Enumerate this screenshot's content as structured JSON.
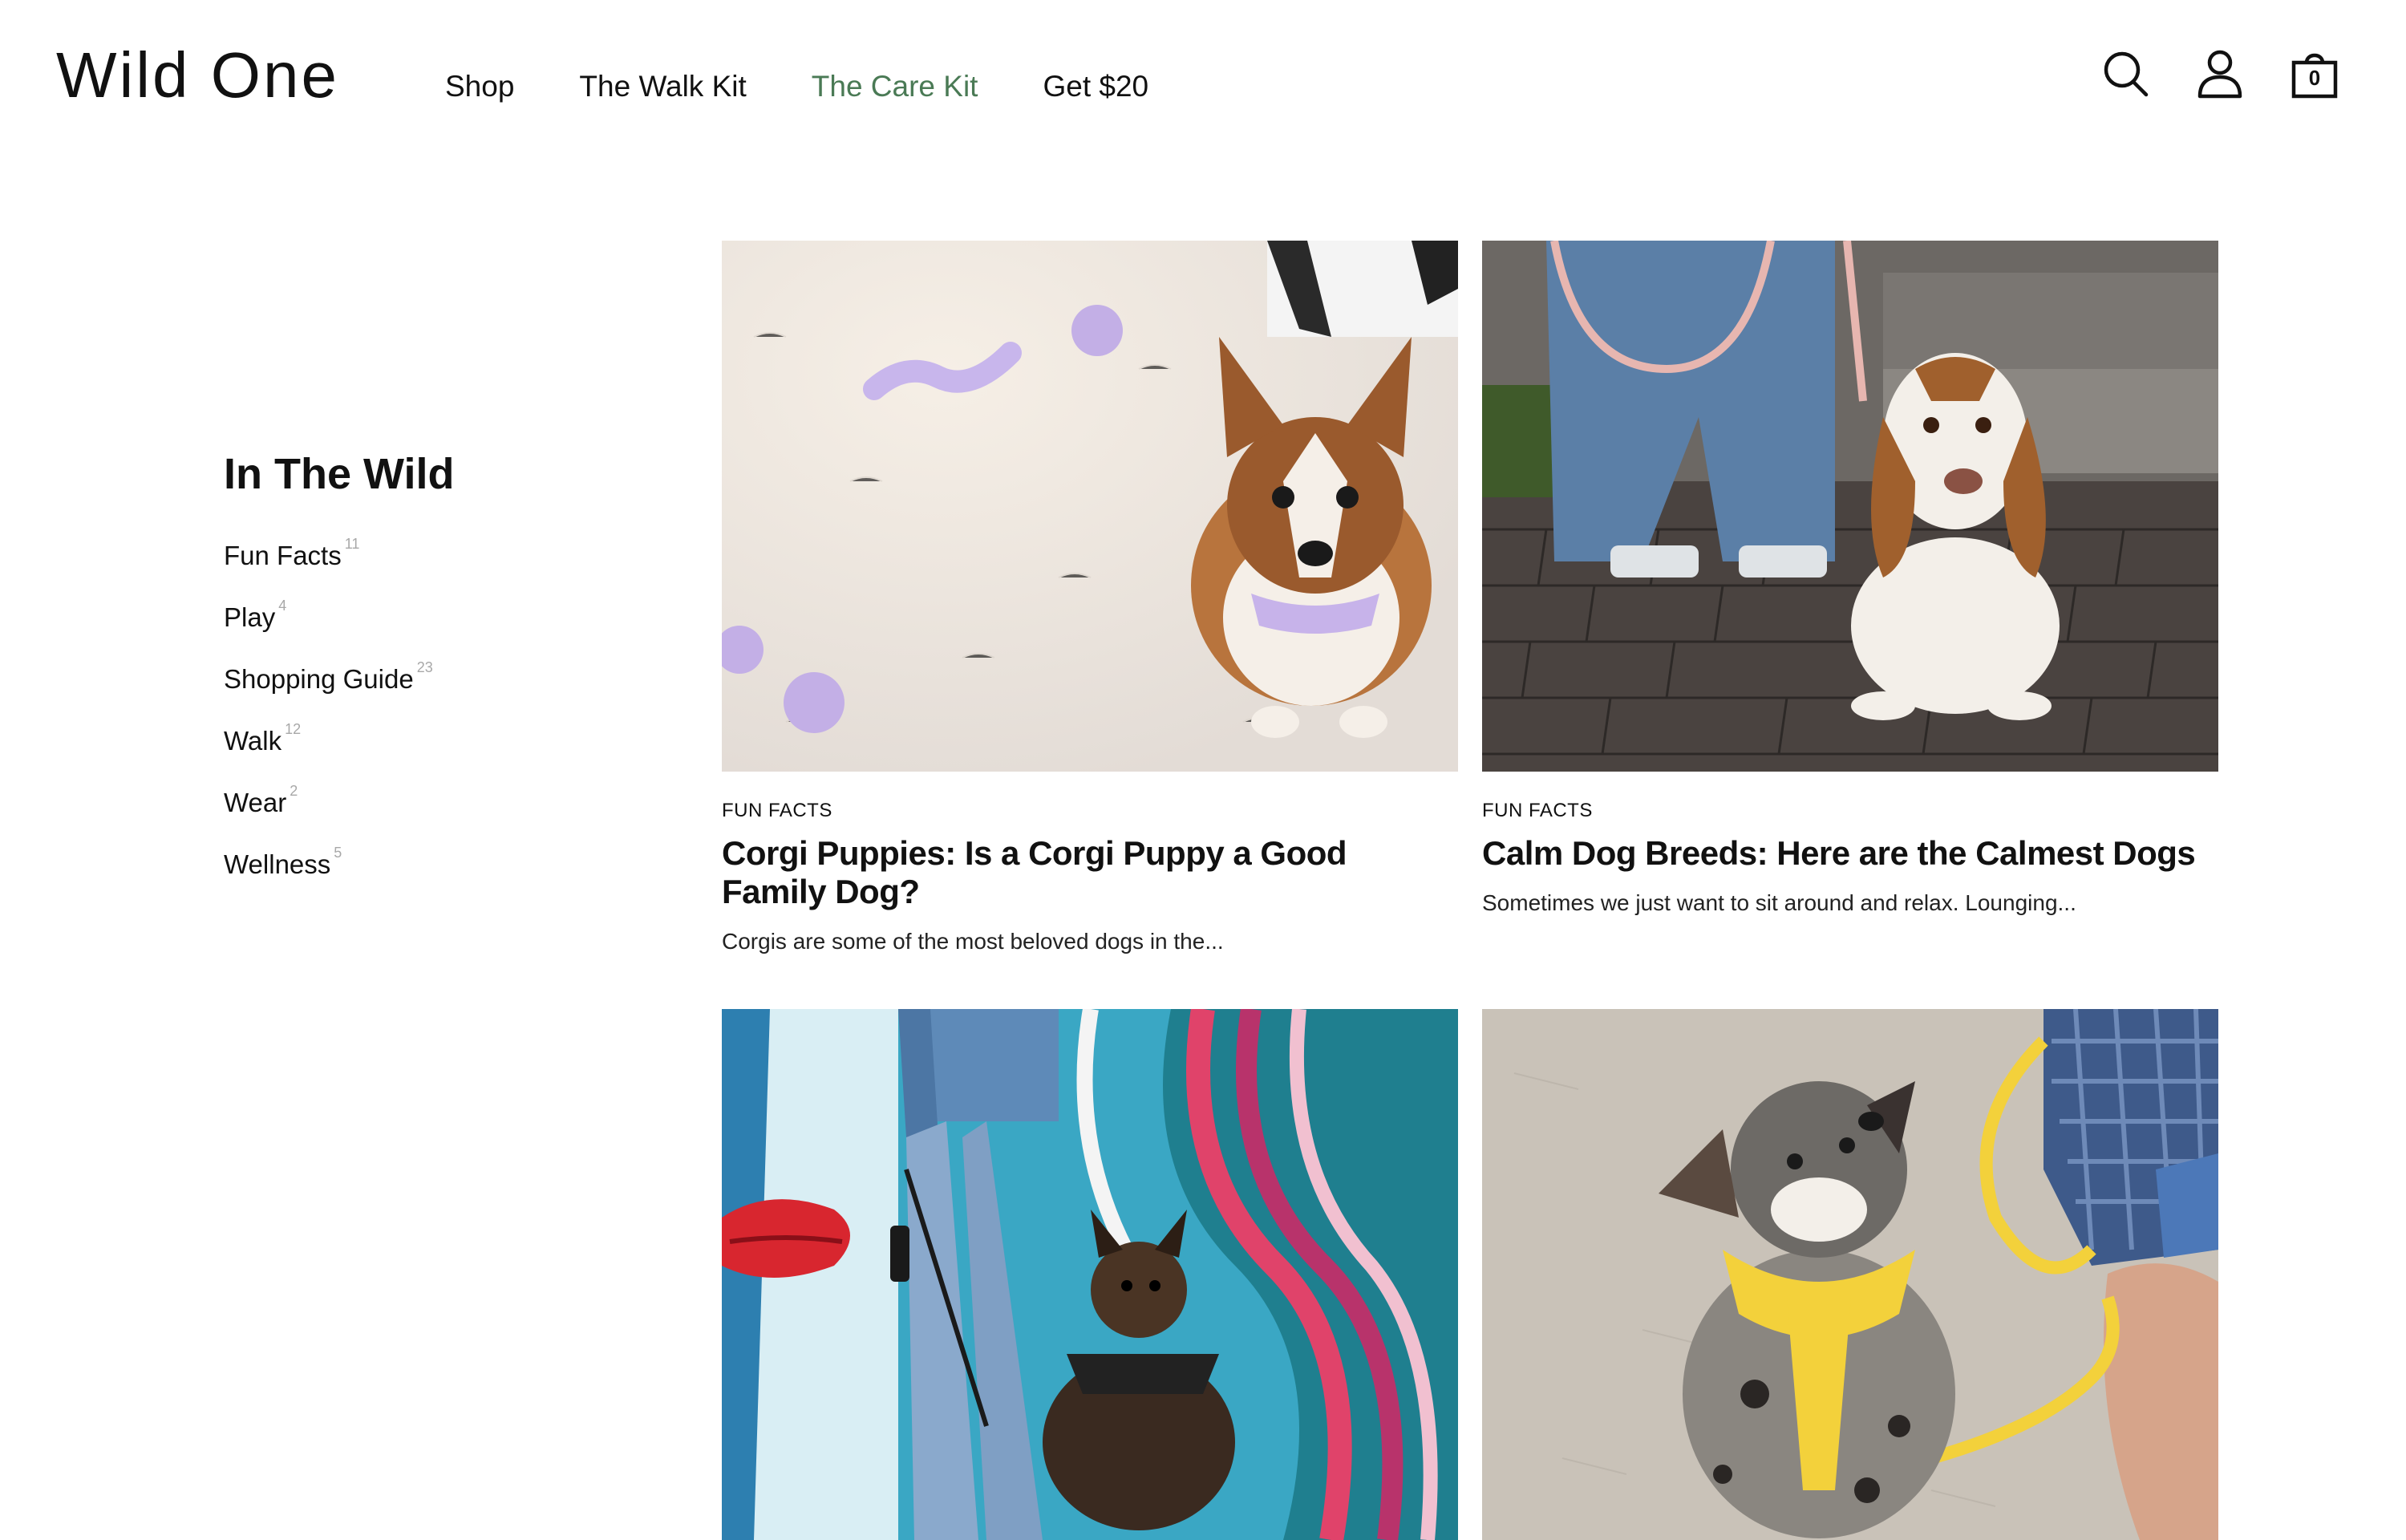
{
  "brand": {
    "logo": "Wild One"
  },
  "nav": [
    {
      "label": "Shop",
      "active": false
    },
    {
      "label": "The Walk Kit",
      "active": false
    },
    {
      "label": "The Care Kit",
      "active": true
    },
    {
      "label": "Get $20",
      "active": false
    }
  ],
  "header_icons": {
    "search": "search-icon",
    "account": "user-icon",
    "cart": "shopping-bag-icon",
    "cart_count": "0"
  },
  "colors": {
    "accent_green": "#4a7a55",
    "text": "#111111",
    "muted": "#a8a8a8"
  },
  "sidebar": {
    "title": "In The Wild",
    "categories": [
      {
        "label": "Fun Facts",
        "count": "11"
      },
      {
        "label": "Play",
        "count": "4"
      },
      {
        "label": "Shopping Guide",
        "count": "23"
      },
      {
        "label": "Walk",
        "count": "12"
      },
      {
        "label": "Wear",
        "count": "2"
      },
      {
        "label": "Wellness",
        "count": "5"
      }
    ]
  },
  "articles": [
    {
      "category": "FUN FACTS",
      "title": "Corgi Puppies: Is a Corgi Puppy a Good Family Dog?",
      "excerpt": "Corgis are some of the most beloved dogs in the...",
      "image": "corgi-on-white-rug-with-purple-toys"
    },
    {
      "category": "FUN FACTS",
      "title": "Calm Dog Breeds: Here are the Calmest Dogs",
      "excerpt": "Sometimes we just want to sit around and relax. Lounging...",
      "image": "basset-hound-on-brick-pavement"
    },
    {
      "image": "dog-in-front-of-colorful-mural"
    },
    {
      "image": "australian-shepherd-with-yellow-leash"
    }
  ]
}
